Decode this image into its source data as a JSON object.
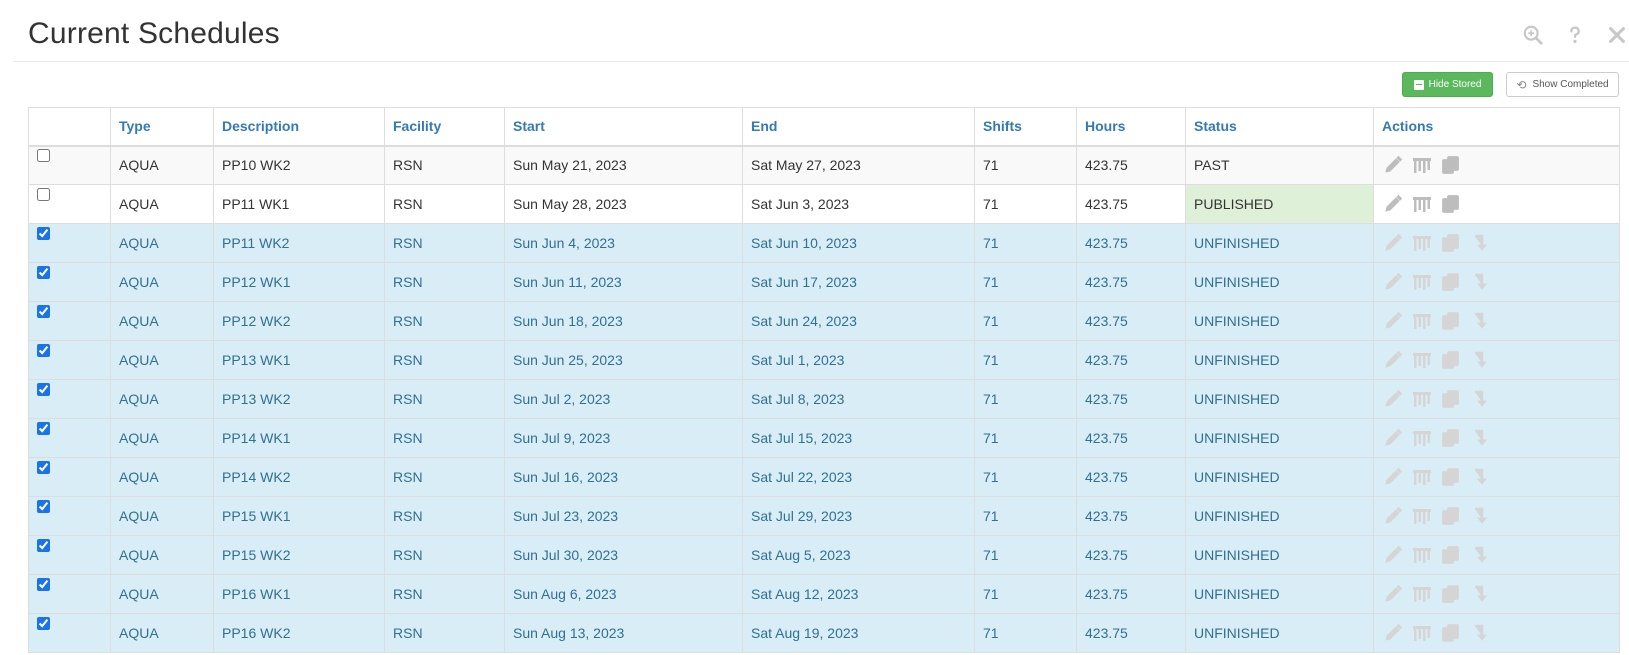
{
  "page": {
    "title": "Current Schedules"
  },
  "header_icons": [
    "zoom-in-icon",
    "help-icon",
    "close-icon"
  ],
  "toolbar": {
    "hide_stored_label": "Hide Stored",
    "show_completed_label": "Show Completed"
  },
  "colors": {
    "accent": "#337ab7",
    "success": "#5cb85c",
    "selected_row": "#d9edf7",
    "published": "#dff0d8"
  },
  "table": {
    "headers": [
      "Type",
      "Description",
      "Facility",
      "Start",
      "End",
      "Shifts",
      "Hours",
      "Status",
      "Actions"
    ],
    "rows": [
      {
        "checked": false,
        "type": "AQUA",
        "description": "PP10 WK2",
        "facility": "RSN",
        "start": "Sun May 21, 2023",
        "end": "Sat May 27, 2023",
        "shifts": "71",
        "hours": "423.75",
        "status": "PAST",
        "actions": [
          "edit-icon",
          "chart-icon",
          "copy-icon"
        ]
      },
      {
        "checked": false,
        "type": "AQUA",
        "description": "PP11 WK1",
        "facility": "RSN",
        "start": "Sun May 28, 2023",
        "end": "Sat Jun 3, 2023",
        "shifts": "71",
        "hours": "423.75",
        "status": "PUBLISHED",
        "actions": [
          "edit-icon",
          "chart-icon",
          "copy-icon"
        ]
      },
      {
        "checked": true,
        "type": "AQUA",
        "description": "PP11 WK2",
        "facility": "RSN",
        "start": "Sun Jun 4, 2023",
        "end": "Sat Jun 10, 2023",
        "shifts": "71",
        "hours": "423.75",
        "status": "UNFINISHED",
        "actions": [
          "edit-icon",
          "chart-icon",
          "copy-icon",
          "publish-arrow-icon"
        ]
      },
      {
        "checked": true,
        "type": "AQUA",
        "description": "PP12 WK1",
        "facility": "RSN",
        "start": "Sun Jun 11, 2023",
        "end": "Sat Jun 17, 2023",
        "shifts": "71",
        "hours": "423.75",
        "status": "UNFINISHED",
        "actions": [
          "edit-icon",
          "chart-icon",
          "copy-icon",
          "publish-arrow-icon"
        ]
      },
      {
        "checked": true,
        "type": "AQUA",
        "description": "PP12 WK2",
        "facility": "RSN",
        "start": "Sun Jun 18, 2023",
        "end": "Sat Jun 24, 2023",
        "shifts": "71",
        "hours": "423.75",
        "status": "UNFINISHED",
        "actions": [
          "edit-icon",
          "chart-icon",
          "copy-icon",
          "publish-arrow-icon"
        ]
      },
      {
        "checked": true,
        "type": "AQUA",
        "description": "PP13 WK1",
        "facility": "RSN",
        "start": "Sun Jun 25, 2023",
        "end": "Sat Jul 1, 2023",
        "shifts": "71",
        "hours": "423.75",
        "status": "UNFINISHED",
        "actions": [
          "edit-icon",
          "chart-icon",
          "copy-icon",
          "publish-arrow-icon"
        ]
      },
      {
        "checked": true,
        "type": "AQUA",
        "description": "PP13 WK2",
        "facility": "RSN",
        "start": "Sun Jul 2, 2023",
        "end": "Sat Jul 8, 2023",
        "shifts": "71",
        "hours": "423.75",
        "status": "UNFINISHED",
        "actions": [
          "edit-icon",
          "chart-icon",
          "copy-icon",
          "publish-arrow-icon"
        ]
      },
      {
        "checked": true,
        "type": "AQUA",
        "description": "PP14 WK1",
        "facility": "RSN",
        "start": "Sun Jul 9, 2023",
        "end": "Sat Jul 15, 2023",
        "shifts": "71",
        "hours": "423.75",
        "status": "UNFINISHED",
        "actions": [
          "edit-icon",
          "chart-icon",
          "copy-icon",
          "publish-arrow-icon"
        ]
      },
      {
        "checked": true,
        "type": "AQUA",
        "description": "PP14 WK2",
        "facility": "RSN",
        "start": "Sun Jul 16, 2023",
        "end": "Sat Jul 22, 2023",
        "shifts": "71",
        "hours": "423.75",
        "status": "UNFINISHED",
        "actions": [
          "edit-icon",
          "chart-icon",
          "copy-icon",
          "publish-arrow-icon"
        ]
      },
      {
        "checked": true,
        "type": "AQUA",
        "description": "PP15 WK1",
        "facility": "RSN",
        "start": "Sun Jul 23, 2023",
        "end": "Sat Jul 29, 2023",
        "shifts": "71",
        "hours": "423.75",
        "status": "UNFINISHED",
        "actions": [
          "edit-icon",
          "chart-icon",
          "copy-icon",
          "publish-arrow-icon"
        ]
      },
      {
        "checked": true,
        "type": "AQUA",
        "description": "PP15 WK2",
        "facility": "RSN",
        "start": "Sun Jul 30, 2023",
        "end": "Sat Aug 5, 2023",
        "shifts": "71",
        "hours": "423.75",
        "status": "UNFINISHED",
        "actions": [
          "edit-icon",
          "chart-icon",
          "copy-icon",
          "publish-arrow-icon"
        ]
      },
      {
        "checked": true,
        "type": "AQUA",
        "description": "PP16 WK1",
        "facility": "RSN",
        "start": "Sun Aug 6, 2023",
        "end": "Sat Aug 12, 2023",
        "shifts": "71",
        "hours": "423.75",
        "status": "UNFINISHED",
        "actions": [
          "edit-icon",
          "chart-icon",
          "copy-icon",
          "publish-arrow-icon"
        ]
      },
      {
        "checked": true,
        "type": "AQUA",
        "description": "PP16 WK2",
        "facility": "RSN",
        "start": "Sun Aug 13, 2023",
        "end": "Sat Aug 19, 2023",
        "shifts": "71",
        "hours": "423.75",
        "status": "UNFINISHED",
        "actions": [
          "edit-icon",
          "chart-icon",
          "copy-icon",
          "publish-arrow-icon"
        ]
      }
    ]
  }
}
